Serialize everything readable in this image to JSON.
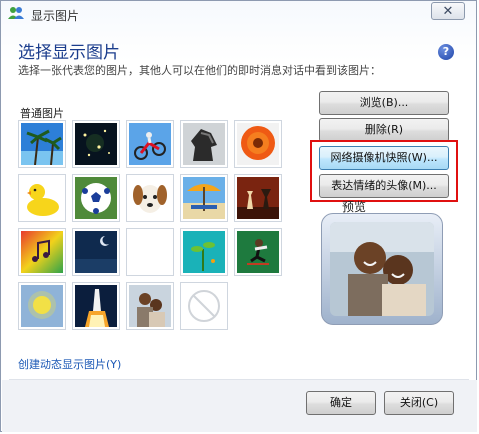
{
  "window": {
    "title": "显示图片",
    "close_label": "✕"
  },
  "header": {
    "heading": "选择显示图片",
    "subtitle": "选择一张代表您的图片，其他人可以在他们的即时消息对话中看到该图片：",
    "help_label": "?"
  },
  "pictures": {
    "section_label": "普通图片",
    "tiles": [
      {
        "name": "palm-trees-picture"
      },
      {
        "name": "night-sky-picture"
      },
      {
        "name": "dirt-bike-picture"
      },
      {
        "name": "chess-knight-picture"
      },
      {
        "name": "orange-flower-picture"
      },
      {
        "name": "rubber-duck-picture"
      },
      {
        "name": "soccer-ball-picture"
      },
      {
        "name": "puppy-picture"
      },
      {
        "name": "beach-umbrella-picture"
      },
      {
        "name": "chess-pieces-picture"
      },
      {
        "name": "music-notes-picture"
      },
      {
        "name": "moon-night-picture"
      },
      {
        "name": "blank-picture"
      },
      {
        "name": "seedling-picture"
      },
      {
        "name": "skateboarder-picture"
      },
      {
        "name": "sun-picture"
      },
      {
        "name": "space-shuttle-picture"
      },
      {
        "name": "family-picture"
      },
      {
        "name": "no-picture"
      }
    ]
  },
  "buttons": {
    "browse": "浏览(B)...",
    "delete": "删除(R)",
    "webcam": "网络摄像机快照(W)...",
    "emotion": "表达情绪的头像(M)..."
  },
  "preview": {
    "label": "预览"
  },
  "footer": {
    "link": "创建动态显示图片(Y)",
    "ok": "确定",
    "close": "关闭(C)"
  }
}
